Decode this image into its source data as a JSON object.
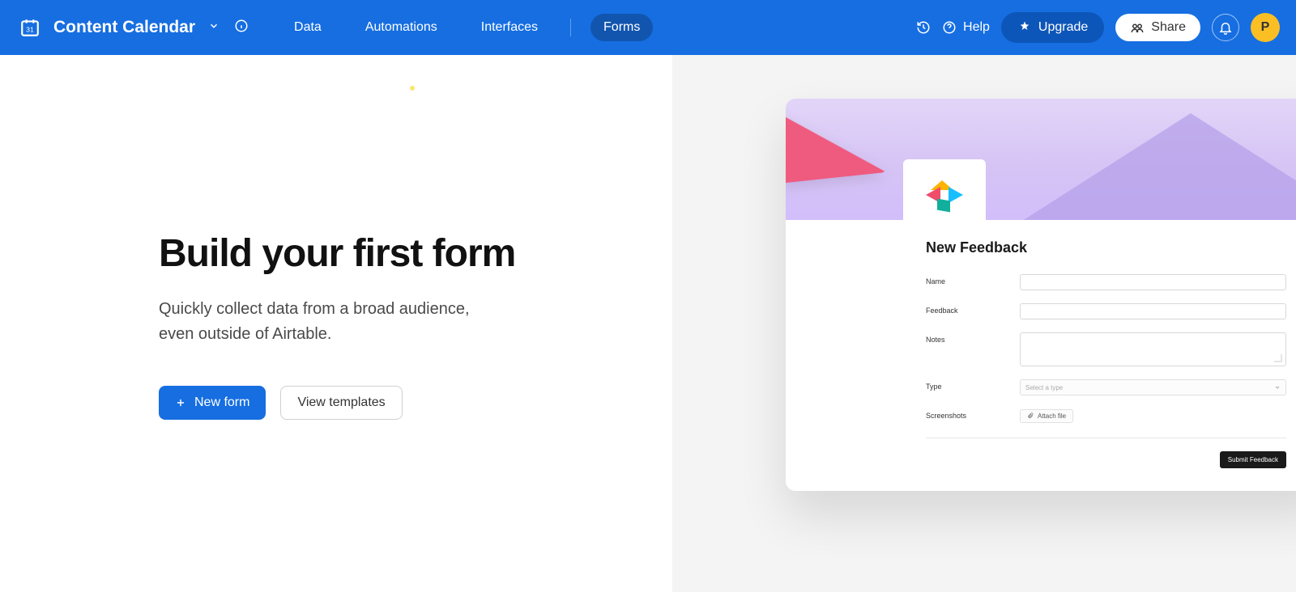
{
  "header": {
    "brand": "Content Calendar",
    "nav": {
      "data": "Data",
      "automations": "Automations",
      "interfaces": "Interfaces",
      "forms": "Forms"
    },
    "help": "Help",
    "upgrade": "Upgrade",
    "share": "Share",
    "avatar_initial": "P"
  },
  "main": {
    "headline": "Build your first form",
    "subtext": "Quickly collect data from a broad audience, even outside of Airtable.",
    "new_form": "New form",
    "view_templates": "View templates"
  },
  "preview": {
    "title": "New Feedback",
    "fields": {
      "name": "Name",
      "feedback": "Feedback",
      "notes": "Notes",
      "type": "Type",
      "type_placeholder": "Select a type",
      "screenshots": "Screenshots",
      "attach": "Attach file"
    },
    "submit": "Submit Feedback"
  }
}
